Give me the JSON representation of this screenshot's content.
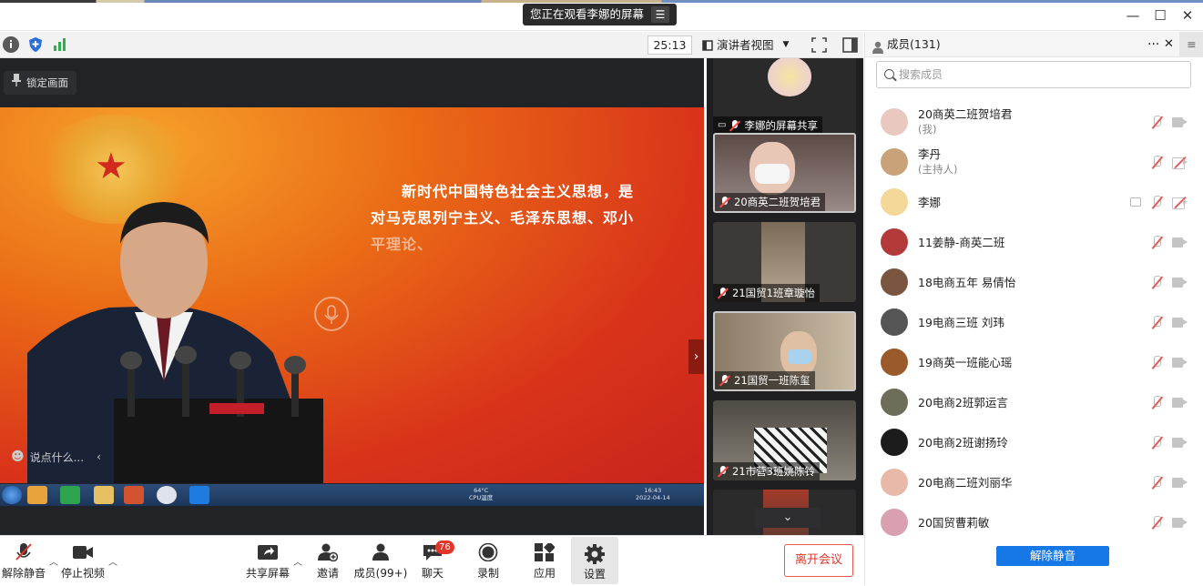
{
  "titlebar": {
    "banner_text": "您正在观看李娜的屏幕",
    "banner_menu_glyph": "☰",
    "minimize_glyph": "—",
    "maximize_glyph": "☐",
    "close_glyph": "✕"
  },
  "toolbar": {
    "timer": "25:13",
    "view_mode": "演讲者视图",
    "icons": [
      "info-icon",
      "shield-icon",
      "signal-icon",
      "fullscreen-icon",
      "layout-icon"
    ]
  },
  "stage": {
    "lock_label": "锁定画面",
    "slide_line1": "新时代中国特色社会主义思想，是",
    "slide_line2": "对马克思列宁主义、毛泽东思想、邓小",
    "slide_line3": "平理论、",
    "chat_placeholder": "说点什么...",
    "tray_line1": "64°C",
    "tray_line2": "CPU温度",
    "clock_time": "16:43",
    "clock_date": "2022-04-14"
  },
  "tiles": [
    {
      "name": "李娜的屏幕共享",
      "kind": "screen-share"
    },
    {
      "name": "20商英二班贺培君",
      "kind": "camera"
    },
    {
      "name": "21国贸1班章璇怡",
      "kind": "camera"
    },
    {
      "name": "21国贸一班陈玺",
      "kind": "camera"
    },
    {
      "name": "21市营3班姚陈铃",
      "kind": "camera"
    }
  ],
  "members_panel": {
    "title": "成员(131)",
    "search_placeholder": "搜索成员",
    "unmute_all": "解除静音",
    "members": [
      {
        "name": "20商英二班贺培君",
        "role": "(我)",
        "cam": "on",
        "avatar_color": "#e9c8c0"
      },
      {
        "name": "李丹",
        "role": "(主持人)",
        "cam": "off",
        "avatar_color": "#c9a27a"
      },
      {
        "name": "李娜",
        "role": "",
        "cam": "off",
        "sharing": true,
        "avatar_color": "#f3d89a"
      },
      {
        "name": "11姜静-商英二班",
        "role": "",
        "cam": "on",
        "avatar_color": "#b23a3a"
      },
      {
        "name": "18电商五年 易倩怡",
        "role": "",
        "cam": "on",
        "avatar_color": "#7a5640"
      },
      {
        "name": "19电商三班 刘玮",
        "role": "",
        "cam": "on",
        "avatar_color": "#555555"
      },
      {
        "name": "19商英一班能心瑶",
        "role": "",
        "cam": "on",
        "avatar_color": "#9a5a2a"
      },
      {
        "name": "20电商2班郭运言",
        "role": "",
        "cam": "on",
        "avatar_color": "#6d6d5a"
      },
      {
        "name": "20电商2班谢扬玲",
        "role": "",
        "cam": "on",
        "avatar_color": "#1c1c1c"
      },
      {
        "name": "20电商二班刘丽华",
        "role": "",
        "cam": "on",
        "avatar_color": "#e8b9a8"
      },
      {
        "name": "20国贸曹莉敏",
        "role": "",
        "cam": "on",
        "avatar_color": "#d9a0b0"
      }
    ]
  },
  "bottombar": {
    "unmute": "解除静音",
    "stop_video": "停止视频",
    "share_screen": "共享屏幕",
    "invite": "邀请",
    "members": "成员(99+)",
    "chat": "聊天",
    "chat_badge": "76",
    "record": "录制",
    "apps": "应用",
    "settings": "设置",
    "leave": "离开会议"
  },
  "colors": {
    "accent": "#1677e6",
    "danger": "#e2352c",
    "slide_red": "#d9341a"
  }
}
